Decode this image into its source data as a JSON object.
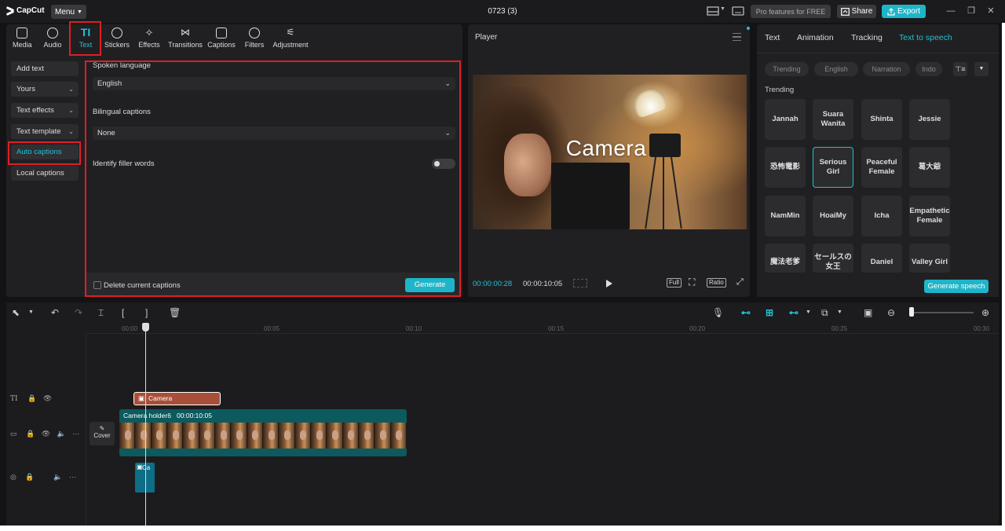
{
  "app": {
    "name": "CapCut",
    "menu_label": "Menu",
    "doc_title": "0723 (3)"
  },
  "header": {
    "pro_label": "Pro features for FREE",
    "share_label": "Share",
    "export_label": "Export"
  },
  "toolbar": {
    "tools": [
      {
        "label": "Media",
        "icon": "media-icon"
      },
      {
        "label": "Audio",
        "icon": "audio-icon"
      },
      {
        "label": "Text",
        "icon": "text-icon",
        "active": true
      },
      {
        "label": "Stickers",
        "icon": "stickers-icon"
      },
      {
        "label": "Effects",
        "icon": "effects-icon"
      },
      {
        "label": "Transitions",
        "icon": "transitions-icon"
      },
      {
        "label": "Captions",
        "icon": "captions-icon"
      },
      {
        "label": "Filters",
        "icon": "filters-icon"
      },
      {
        "label": "Adjustment",
        "icon": "adjustment-icon"
      }
    ]
  },
  "subnav": {
    "items": [
      {
        "label": "Add text"
      },
      {
        "label": "Yours"
      },
      {
        "label": "Text effects"
      },
      {
        "label": "Text template"
      },
      {
        "label": "Auto captions",
        "active": true
      },
      {
        "label": "Local captions"
      }
    ]
  },
  "captions": {
    "spoken_language_label": "Spoken language",
    "spoken_language_value": "English",
    "bilingual_label": "Bilingual captions",
    "bilingual_value": "None",
    "filler_label": "Identify filler words",
    "delete_label": "Delete current captions",
    "generate_label": "Generate"
  },
  "player": {
    "title": "Player",
    "caption_text": "Camera",
    "time_current": "00:00:00:28",
    "time_total": "00:00:10:05",
    "full_label": "Full",
    "ratio_label": "Ratio"
  },
  "right_panel": {
    "tabs": [
      "Text",
      "Animation",
      "Tracking",
      "Text to speech"
    ],
    "active_tab": "Text to speech",
    "chips": [
      "Trending",
      "English",
      "Narration",
      "Indo"
    ],
    "section_label": "Trending",
    "voices": [
      "Jannah",
      "Suara Wanita",
      "Shinta",
      "Jessie",
      "恐怖電影",
      "Serious Girl",
      "Peaceful Female",
      "葛大爺",
      "NamMin",
      "HoaiMy",
      "Icha",
      "Empathetic Female",
      "魔法老爹",
      "セールスの女王",
      "Daniel",
      "Valley Girl"
    ],
    "selected_voice": "Serious Girl",
    "generate_speech_label": "Generate speech"
  },
  "timeline": {
    "ticks": [
      "00:00",
      "00:05",
      "00:10",
      "00:15",
      "00:20",
      "00:25",
      "00:30"
    ],
    "text_clip_label": "Camera",
    "video_clip_name": "Camera holder6",
    "video_clip_duration": "00:00:10:05",
    "cover_label": "Cover",
    "audio_clip_label": "Ca"
  },
  "colors": {
    "accent": "#1fb5c9",
    "highlight": "#e01e26",
    "text_clip": "#a84f3a",
    "video_clip": "#0c5a5e"
  }
}
